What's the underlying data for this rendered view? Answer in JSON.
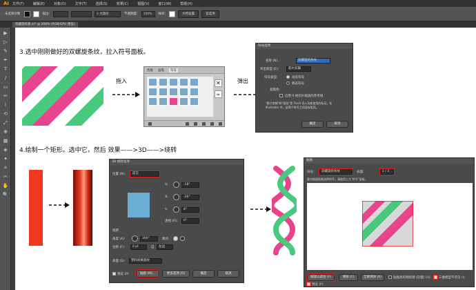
{
  "app": {
    "logo": "Ai"
  },
  "menu": [
    "文件(F)",
    "编辑(E)",
    "对象(O)",
    "文字(T)",
    "选择(S)",
    "效果(C)",
    "视图(V)",
    "窗口(W)",
    "帮助(H)"
  ],
  "controlbar": {
    "selection": "未选择对象",
    "stroke_label": "描边:",
    "brush": "2 点圆形",
    "opacity_label": "不透明度:",
    "opacity": "100%",
    "style_label": "样式:",
    "doc_setup": "文档设置",
    "prefs": "首选项"
  },
  "tab": {
    "title": "双螺旋绞索.ai* @ 208% (RGB/GPU 预览)"
  },
  "tools": [
    "▶",
    "▷",
    "✎",
    "✒",
    "T",
    "/",
    "▭",
    "✏",
    "⌇",
    "⟲",
    "⤢",
    "✥",
    "▦",
    "◈",
    "✦",
    "⌗",
    "✂",
    "✋",
    "🔍"
  ],
  "step3": {
    "title": "3.选中刚刚做好的双螺旋条纹，拉入符号面板。",
    "drag_in": "拖入",
    "pop_out": "弹出"
  },
  "symbols_panel": {
    "tabs": [
      "色板",
      "画笔",
      "符号"
    ]
  },
  "symbol_options": {
    "title": "符号选项",
    "name_label": "名称 (N):",
    "name_value": "双螺旋的条纹",
    "export_type_label": "导出类型 (E):",
    "export_type_value": "影片剪辑",
    "symbol_type_label": "符号类型:",
    "dynamic": "动态符号",
    "static": "静态符号",
    "registration_label": "套版色:",
    "guides": "启用 9 格切片缩放的参考线",
    "info": "\"影片剪辑\"和\"图形\"是 Flash 导入功能使用的标记。在 Illustrator 中，这两个符号之间没有差异。",
    "ok": "确定",
    "cancel": "取消"
  },
  "step4": {
    "title": "4.绘制一个矩形。选中它，然后 效果——>3D——>绕转"
  },
  "revolve_dialog": {
    "title": "3D 绕转选项",
    "position_label": "位置 (N):",
    "position_value": "前方",
    "angle_x": "-18°",
    "angle_y": "-26°",
    "angle_z": "8°",
    "perspective_label": "透视 (R):",
    "perspective": "0°",
    "revolve_label": "绕转",
    "angle_label": "角度 (A):",
    "angle_value": "360°",
    "cap_label": "端点:",
    "offset_label": "位移 (F):",
    "offset_value": "0 pt",
    "from_label": "自",
    "from_value": "左边",
    "surface_label": "表面 (S):",
    "surface_value": "塑料效果底纹",
    "preview": "预览 (P)",
    "map": "贴图 (M)...",
    "more": "更多选项 (O)",
    "ok": "确定",
    "cancel": "取消"
  },
  "map_dialog": {
    "title": "贴图",
    "symbol_label": "符号:",
    "symbol_value": "双螺旋的条纹",
    "surface_label": "表面:",
    "surface_value": "1 / 3",
    "hint": "要对曲面贴图选择符号，请使用上方\"符号\"面板。",
    "fit": "缩放以适合 (F)",
    "clear": "清除 (C)",
    "clear_all": "全部清除 (A)",
    "shade": "贴图具有明暗调 (较慢) (H)",
    "invisible": "三维模型不可见 (I)",
    "preview": "预览 (P)"
  }
}
